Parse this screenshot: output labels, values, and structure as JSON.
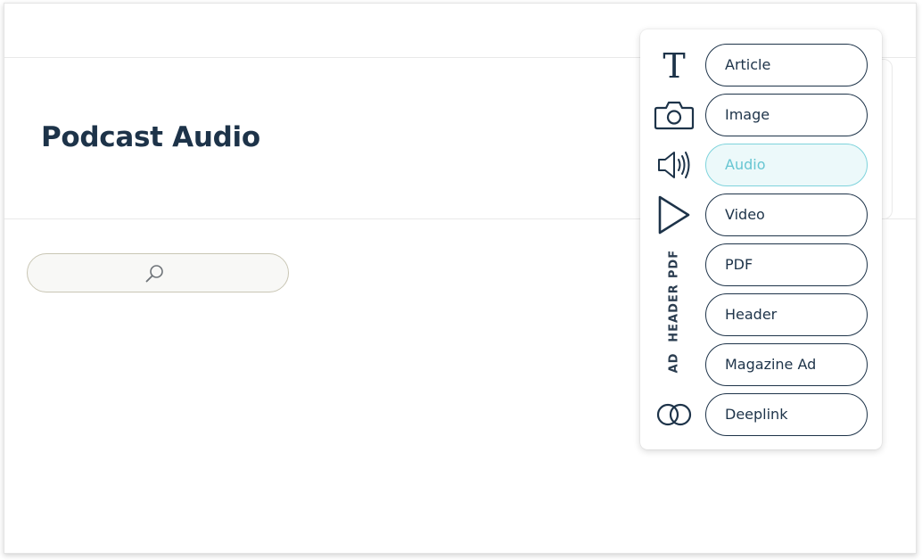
{
  "page": {
    "title": "Podcast Audio"
  },
  "search": {
    "placeholder": "",
    "value": "",
    "icon": "magnifier-icon"
  },
  "insert_menu": {
    "items": [
      {
        "label": "Article",
        "icon": "text-t-icon"
      },
      {
        "label": "Image",
        "icon": "camera-icon"
      },
      {
        "label": "Audio",
        "icon": "speaker-icon",
        "active": true
      },
      {
        "label": "Video",
        "icon": "play-triangle-icon"
      },
      {
        "label": "PDF",
        "icon": "pdf-word-icon"
      },
      {
        "label": "Header",
        "icon": "header-word-icon"
      },
      {
        "label": "Magazine Ad",
        "icon": "ad-word-icon"
      },
      {
        "label": "Deeplink",
        "icon": "linked-rings-icon"
      }
    ],
    "vertical_words": [
      "PDF",
      "HEADER",
      "AD"
    ]
  },
  "colors": {
    "text_dark": "#1d3349",
    "active_accent": "#67c6d2",
    "active_fill": "#ecf9fa",
    "search_border": "#c9c6b4"
  }
}
